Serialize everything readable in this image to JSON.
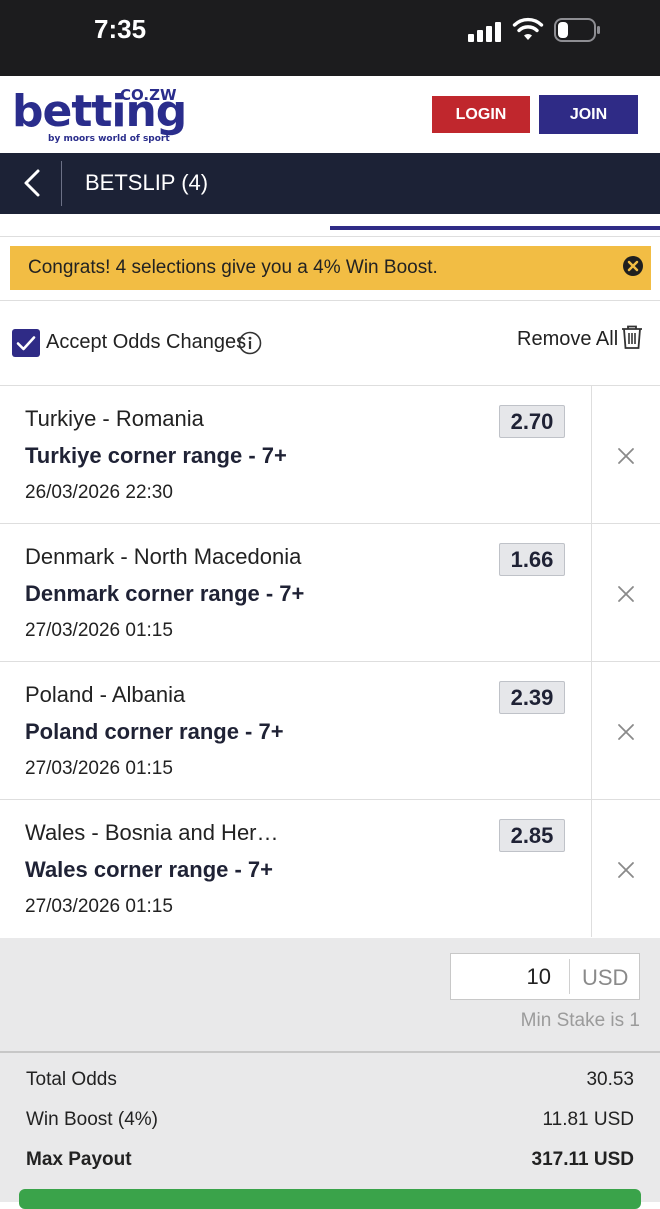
{
  "status_bar": {
    "time": "7:35"
  },
  "site_header": {
    "logo": {
      "word": "betting",
      "tld": "CO.ZW",
      "tagline": "by moors world of sport"
    },
    "login_label": "LOGIN",
    "join_label": "JOIN"
  },
  "betslip_header": {
    "title": "BETSLIP (4)"
  },
  "boost_banner": {
    "text": "Congrats! 4 selections give you a 4% Win Boost."
  },
  "options": {
    "accept_odds_label": "Accept Odds Changes",
    "accept_odds_checked": true,
    "remove_all_label": "Remove All"
  },
  "bets": [
    {
      "match": "Turkiye  -  Romania",
      "market": "Turkiye corner range - 7+",
      "datetime": "26/03/2026 22:30",
      "odds": "2.70"
    },
    {
      "match": "Denmark  -  North Macedonia",
      "market": "Denmark corner range - 7+",
      "datetime": "27/03/2026 01:15",
      "odds": "1.66"
    },
    {
      "match": "Poland  -  Albania",
      "market": "Poland corner range - 7+",
      "datetime": "27/03/2026 01:15",
      "odds": "2.39"
    },
    {
      "match": "Wales  -  Bosnia and Her…",
      "market": "Wales corner range - 7+",
      "datetime": "27/03/2026 01:15",
      "odds": "2.85"
    }
  ],
  "stake": {
    "value": "10",
    "currency": "USD",
    "min_stake_text": "Min Stake is 1"
  },
  "summary": {
    "total_odds_label": "Total Odds",
    "total_odds_value": "30.53",
    "win_boost_label": "Win Boost (4%)",
    "win_boost_value": "11.81 USD",
    "max_payout_label": "Max Payout",
    "max_payout_value": "317.11 USD"
  },
  "colors": {
    "brand_navy": "#2a2d8c",
    "login_red": "#c0272d",
    "join_purple": "#2f2b86",
    "header_dark": "#1c2236",
    "boost_yellow": "#f2bd44",
    "place_bet_green": "#3aa34a"
  },
  "icons": [
    "back-chevron-icon",
    "info-icon",
    "trash-icon",
    "close-icon",
    "checkmark-icon"
  ]
}
